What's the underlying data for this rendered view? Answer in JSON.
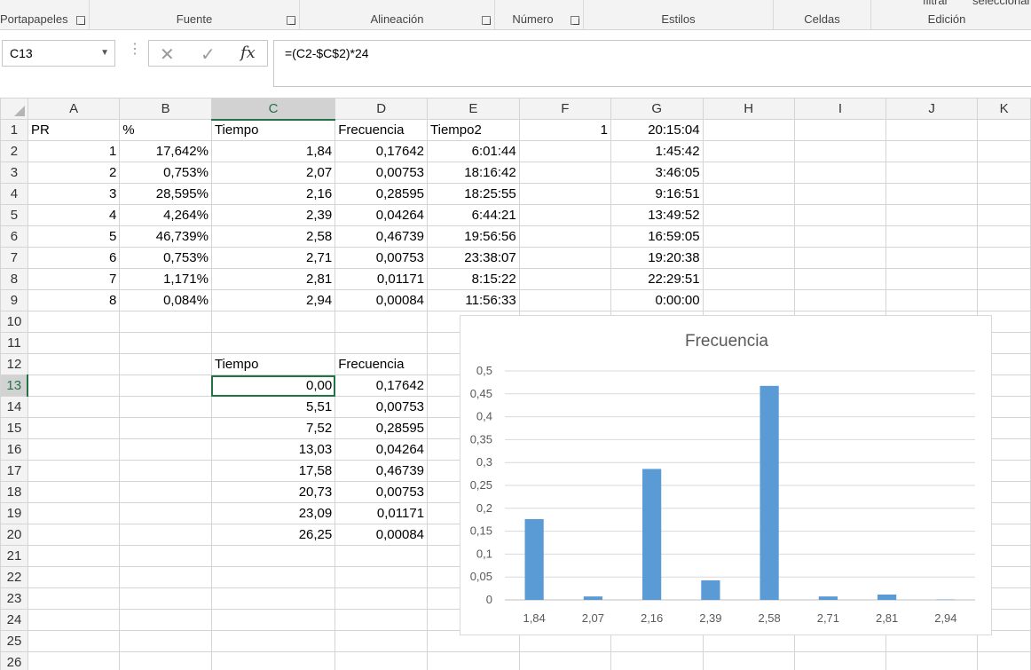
{
  "ribbon": {
    "groups": [
      "Portapapeles",
      "Fuente",
      "Alineación",
      "Número",
      "Estilos",
      "Celdas",
      "Edición"
    ],
    "cut_text_1": "filtrar",
    "cut_text_2": "seleccionar"
  },
  "formula_bar": {
    "name_box": "C13",
    "formula": "=(C2-$C$2)*24",
    "fx_label": "fx"
  },
  "columns": [
    "A",
    "B",
    "C",
    "D",
    "E",
    "F",
    "G",
    "H",
    "I",
    "J",
    "K"
  ],
  "rows": [
    {
      "n": "1",
      "A": "PR",
      "B": "%",
      "C": "Tiempo",
      "D": "Frecuencia",
      "E": "Tiempo2",
      "F": "1",
      "G": "20:15:04"
    },
    {
      "n": "2",
      "A": "1",
      "B": "17,642%",
      "C": "1,84",
      "D": "0,17642",
      "E": "6:01:44",
      "F": "",
      "G": "1:45:42"
    },
    {
      "n": "3",
      "A": "2",
      "B": "0,753%",
      "C": "2,07",
      "D": "0,00753",
      "E": "18:16:42",
      "F": "",
      "G": "3:46:05"
    },
    {
      "n": "4",
      "A": "3",
      "B": "28,595%",
      "C": "2,16",
      "D": "0,28595",
      "E": "18:25:55",
      "F": "",
      "G": "9:16:51"
    },
    {
      "n": "5",
      "A": "4",
      "B": "4,264%",
      "C": "2,39",
      "D": "0,04264",
      "E": "6:44:21",
      "F": "",
      "G": "13:49:52"
    },
    {
      "n": "6",
      "A": "5",
      "B": "46,739%",
      "C": "2,58",
      "D": "0,46739",
      "E": "19:56:56",
      "F": "",
      "G": "16:59:05"
    },
    {
      "n": "7",
      "A": "6",
      "B": "0,753%",
      "C": "2,71",
      "D": "0,00753",
      "E": "23:38:07",
      "F": "",
      "G": "19:20:38"
    },
    {
      "n": "8",
      "A": "7",
      "B": "1,171%",
      "C": "2,81",
      "D": "0,01171",
      "E": "8:15:22",
      "F": "",
      "G": "22:29:51"
    },
    {
      "n": "9",
      "A": "8",
      "B": "0,084%",
      "C": "2,94",
      "D": "0,00084",
      "E": "11:56:33",
      "F": "",
      "G": "0:00:00"
    },
    {
      "n": "10"
    },
    {
      "n": "11"
    },
    {
      "n": "12",
      "C": "Tiempo",
      "D": "Frecuencia"
    },
    {
      "n": "13",
      "C": "0,00",
      "D": "0,17642"
    },
    {
      "n": "14",
      "C": "5,51",
      "D": "0,00753"
    },
    {
      "n": "15",
      "C": "7,52",
      "D": "0,28595"
    },
    {
      "n": "16",
      "C": "13,03",
      "D": "0,04264"
    },
    {
      "n": "17",
      "C": "17,58",
      "D": "0,46739"
    },
    {
      "n": "18",
      "C": "20,73",
      "D": "0,00753"
    },
    {
      "n": "19",
      "C": "23,09",
      "D": "0,01171"
    },
    {
      "n": "20",
      "C": "26,25",
      "D": "0,00084"
    },
    {
      "n": "21"
    },
    {
      "n": "22"
    },
    {
      "n": "23"
    },
    {
      "n": "24"
    },
    {
      "n": "25"
    },
    {
      "n": "26"
    }
  ],
  "selection": {
    "cell": "C13",
    "column": "C",
    "row": "13"
  },
  "chart_data": {
    "type": "bar",
    "title": "Frecuencia",
    "categories": [
      "1,84",
      "2,07",
      "2,16",
      "2,39",
      "2,58",
      "2,71",
      "2,81",
      "2,94"
    ],
    "values": [
      0.17642,
      0.00753,
      0.28595,
      0.04264,
      0.46739,
      0.00753,
      0.01171,
      0.00084
    ],
    "ylim": [
      0,
      0.5
    ],
    "yticks": [
      "0",
      "0,05",
      "0,1",
      "0,15",
      "0,2",
      "0,25",
      "0,3",
      "0,35",
      "0,4",
      "0,45",
      "0,5"
    ],
    "color": "#5b9bd5",
    "grid": true,
    "legend": "none"
  }
}
